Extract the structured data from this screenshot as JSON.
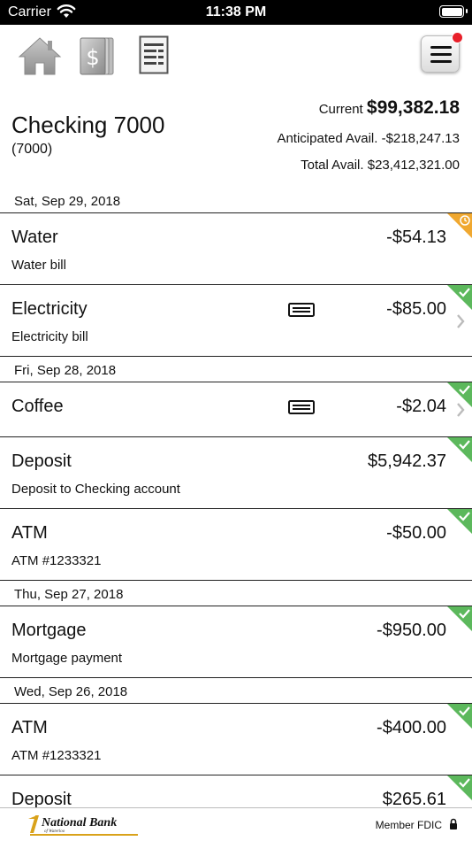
{
  "status_bar": {
    "carrier": "Carrier",
    "time": "11:38 PM"
  },
  "toolbar": {
    "icons": [
      "home-icon",
      "dollar-statements-icon",
      "register-icon",
      "menu-icon"
    ]
  },
  "account": {
    "name": "Checking 7000",
    "number": "(7000)",
    "current_label": "Current",
    "current_value": "$99,382.18",
    "anticipated": "Anticipated Avail. -$218,247.13",
    "total": "Total Avail. $23,412,321.00"
  },
  "dates": [
    "Sat, Sep 29, 2018",
    "Fri, Sep 28, 2018",
    "Thu, Sep 27, 2018",
    "Wed, Sep 26, 2018"
  ],
  "transactions": [
    {
      "title": "Water",
      "desc": "Water bill",
      "amount": "-$54.13",
      "status": "pending"
    },
    {
      "title": "Electricity",
      "desc": "Electricity bill",
      "amount": "-$85.00",
      "status": "cleared"
    },
    {
      "title": "Coffee",
      "desc": "",
      "amount": "-$2.04",
      "status": "cleared"
    },
    {
      "title": "Deposit",
      "desc": "Deposit to Checking account",
      "amount": "$5,942.37",
      "status": "cleared"
    },
    {
      "title": "ATM",
      "desc": "ATM #1233321",
      "amount": "-$50.00",
      "status": "cleared"
    },
    {
      "title": "Mortgage",
      "desc": "Mortgage payment",
      "amount": "-$950.00",
      "status": "cleared"
    },
    {
      "title": "ATM",
      "desc": "ATM #1233321",
      "amount": "-$400.00",
      "status": "cleared"
    },
    {
      "title": "Deposit",
      "desc": "",
      "amount": "$265.61",
      "status": "cleared"
    }
  ],
  "colors": {
    "cleared": "#5cb85c",
    "pending": "#f0a830",
    "notification": "#e8202a"
  },
  "footer": {
    "bank_name": "National Bank",
    "bank_sub": "of Waterloo",
    "fdic": "Member FDIC"
  }
}
